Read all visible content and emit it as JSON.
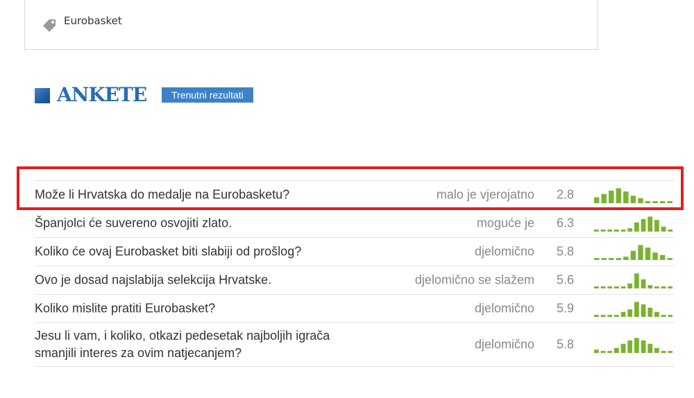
{
  "tag": {
    "icon": "tag-icon",
    "label": "Eurobasket"
  },
  "section": {
    "title": "ANKETE",
    "results_button": "Trenutni rezultati"
  },
  "colors": {
    "accent_blue": "#3c82c8",
    "bar_green": "#7ab32e",
    "highlight_red": "#e41d1d"
  },
  "polls": [
    {
      "question": "Može li Hrvatska do medalje na Eurobasketu?",
      "answer": "malo je vjerojatno",
      "score": "2.8",
      "distribution": [
        0.35,
        0.55,
        0.75,
        0.9,
        0.7,
        0.45,
        0.3,
        0.12,
        0.12,
        0.12,
        0.12
      ]
    },
    {
      "question": "Španjolci će suvereno osvojiti zlato.",
      "answer": "moguće je",
      "score": "6.3",
      "distribution": [
        0.12,
        0.12,
        0.12,
        0.12,
        0.12,
        0.2,
        0.55,
        0.75,
        0.9,
        0.7,
        0.3,
        0.12
      ]
    },
    {
      "question": "Koliko će ovaj Eurobasket biti slabiji od prošlog?",
      "answer": "djelomično",
      "score": "5.8",
      "distribution": [
        0.12,
        0.12,
        0.12,
        0.12,
        0.2,
        0.55,
        0.9,
        0.75,
        0.45,
        0.3,
        0.12
      ]
    },
    {
      "question": "Ovo je dosad najslabija selekcija Hrvatske.",
      "answer": "djelomično se slažem",
      "score": "5.6",
      "distribution": [
        0.12,
        0.12,
        0.12,
        0.12,
        0.12,
        0.3,
        0.9,
        0.55,
        0.2,
        0.12,
        0.12,
        0.12
      ]
    },
    {
      "question": "Koliko mislite pratiti Eurobasket?",
      "answer": "djelomično",
      "score": "5.9",
      "distribution": [
        0.12,
        0.12,
        0.12,
        0.12,
        0.3,
        0.45,
        0.9,
        0.75,
        0.55,
        0.3,
        0.12,
        0.12
      ]
    },
    {
      "question": "Jesu li vam, i koliko, otkazi pedesetak najboljih igrača smanjili interes za ovim natjecanjem?",
      "answer": "djelomično",
      "score": "5.8",
      "distribution": [
        0.2,
        0.12,
        0.12,
        0.3,
        0.55,
        0.75,
        0.9,
        0.75,
        0.55,
        0.3,
        0.12,
        0.12
      ]
    }
  ]
}
